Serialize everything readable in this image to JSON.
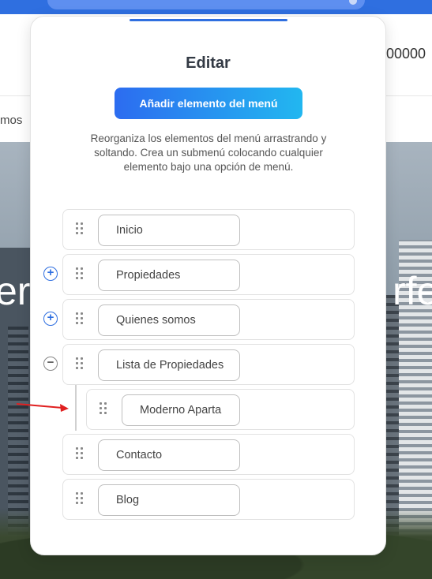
{
  "background": {
    "header_number": "00000",
    "nav_text": "mos",
    "hero_text_left": "er",
    "hero_text_right": "rfe"
  },
  "modal": {
    "title": "Editar",
    "add_button_label": "Añadir elemento del menú",
    "instructions": "Reorganiza los elementos del menú arrastrando y soltando. Crea un submenú colocando cualquier elemento bajo una opción de menú.",
    "items": [
      {
        "label": "Inicio",
        "toggle": ""
      },
      {
        "label": "Propiedades",
        "toggle": "+"
      },
      {
        "label": "Quienes somos",
        "toggle": "+"
      },
      {
        "label": "Lista de Propiedades",
        "toggle": "−"
      },
      {
        "label": "Moderno Aparta",
        "toggle": "",
        "child": true
      },
      {
        "label": "Contacto",
        "toggle": ""
      },
      {
        "label": "Blog",
        "toggle": ""
      }
    ]
  },
  "colors": {
    "accent": "#2f6fe0",
    "button_gradient_start": "#2c6cf0",
    "button_gradient_end": "#22b7f0",
    "annotation_arrow": "#e02020"
  },
  "icons": {
    "drag": "drag-handle-icon",
    "expand": "plus-circle-icon",
    "collapse": "minus-circle-icon"
  }
}
